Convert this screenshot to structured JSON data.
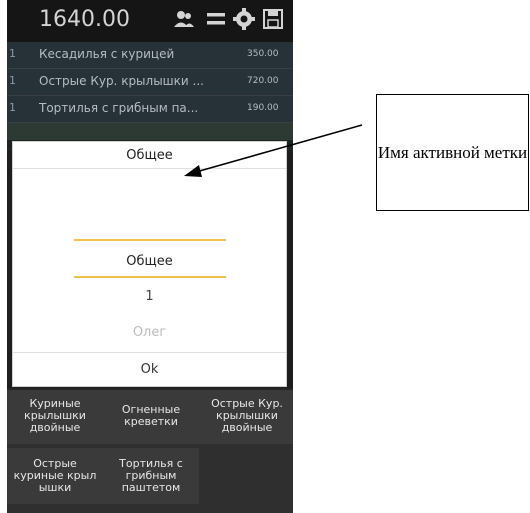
{
  "header": {
    "total": "1640.00",
    "icons": [
      "users-icon",
      "menu-icon",
      "settings-icon",
      "save-icon"
    ]
  },
  "orders": [
    {
      "num": "1",
      "name": "Кесадилья с курицей",
      "price": "350.00"
    },
    {
      "num": "1",
      "name": "Острые Кур. крылышки ...",
      "price": "720.00"
    },
    {
      "num": "1",
      "name": "Тортилья с грибным па...",
      "price": "190.00"
    }
  ],
  "dialog": {
    "title": "Общее",
    "picker": {
      "selected": "Общее",
      "items": [
        "1",
        "Олег"
      ]
    },
    "ok_label": "Ok"
  },
  "tiles": [
    {
      "label": "Куриные крылышки двойные"
    },
    {
      "label": "Огненные креветки"
    },
    {
      "label": "Острые Кур. крылышки двойные"
    },
    {
      "label": "Острые куриные крыл ышки"
    },
    {
      "label": "Тортилья с грибным паштетом"
    }
  ],
  "annotation": {
    "text": "Имя активной метки"
  },
  "colors": {
    "topbar": "#151515",
    "row_bg": "#263238",
    "picker_line": "#f0c14b",
    "dialog_bg": "#ffffff"
  }
}
